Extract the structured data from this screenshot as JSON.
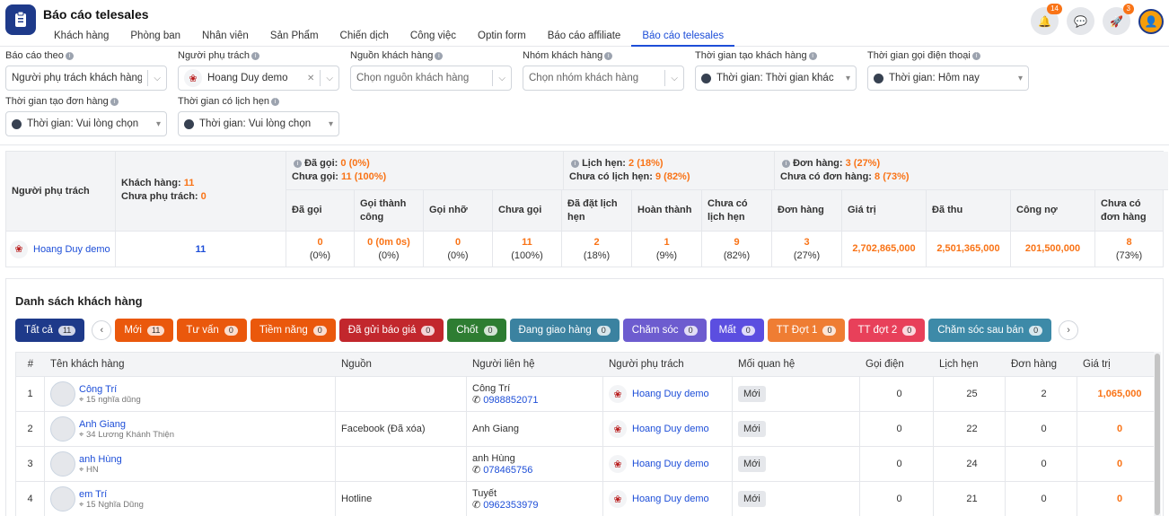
{
  "app": {
    "title": "Báo cáo telesales"
  },
  "nav": {
    "tabs": [
      "Khách hàng",
      "Phòng ban",
      "Nhân viên",
      "Sản Phẩm",
      "Chiến dịch",
      "Công việc",
      "Optin form",
      "Báo cáo affiliate",
      "Báo cáo telesales"
    ],
    "active": "Báo cáo telesales"
  },
  "header": {
    "notif_count": "14",
    "rocket_count": "3"
  },
  "filters": {
    "report_by": {
      "label": "Báo cáo theo",
      "value": "Người phụ trách khách hàng"
    },
    "owner": {
      "label": "Người phụ trách",
      "value": "Hoang Duy demo"
    },
    "source": {
      "label": "Nguồn khách hàng",
      "placeholder": "Chọn nguồn khách hàng"
    },
    "group": {
      "label": "Nhóm khách hàng",
      "placeholder": "Chọn nhóm khách hàng"
    },
    "created_time": {
      "label": "Thời gian tạo khách hàng",
      "value": "Thời gian: Thời gian khác"
    },
    "call_time": {
      "label": "Thời gian gọi điện thoại",
      "value": "Thời gian: Hôm nay"
    },
    "order_time": {
      "label": "Thời gian tạo đơn hàng",
      "value": "Thời gian: Vui lòng chọn"
    },
    "appt_time": {
      "label": "Thời gian có lịch hẹn",
      "value": "Thời gian: Vui lòng chọn"
    }
  },
  "summary": {
    "owner_header": "Người phụ trách",
    "customers_label": "Khách hàng:",
    "customers_value": "11",
    "unassigned_label": "Chưa phụ trách:",
    "unassigned_value": "0",
    "called_label": "Đã gọi:",
    "called_value": "0 (0%)",
    "not_called_label": "Chưa gọi:",
    "not_called_value": "11 (100%)",
    "appt_label": "Lịch hẹn:",
    "appt_value": "2 (18%)",
    "no_appt_label": "Chưa có lịch hẹn:",
    "no_appt_value": "9 (82%)",
    "orders_label": "Đơn hàng:",
    "orders_value": "3 (27%)",
    "no_orders_label": "Chưa có đơn hàng:",
    "no_orders_value": "8 (73%)",
    "cols": [
      "Đã gọi",
      "Gọi thành công",
      "Gọi nhỡ",
      "Chưa gọi",
      "Đã đặt lịch hẹn",
      "Hoàn thành",
      "Chưa có lịch hẹn",
      "Đơn hàng",
      "Giá trị",
      "Đã thu",
      "Công nợ",
      "Chưa có đơn hàng"
    ],
    "row": {
      "owner": "Hoang Duy demo",
      "customers": "11",
      "vals": [
        [
          "0",
          "(0%)"
        ],
        [
          "0 (0m 0s)",
          "(0%)"
        ],
        [
          "0",
          "(0%)"
        ],
        [
          "11",
          "(100%)"
        ],
        [
          "2",
          "(18%)"
        ],
        [
          "1",
          "(9%)"
        ],
        [
          "9",
          "(82%)"
        ],
        [
          "3",
          "(27%)"
        ],
        [
          "2,702,865,000",
          ""
        ],
        [
          "2,501,365,000",
          ""
        ],
        [
          "201,500,000",
          ""
        ],
        [
          "8",
          "(73%)"
        ]
      ]
    }
  },
  "list": {
    "title": "Danh sách khách hàng",
    "chips": [
      {
        "label": "Tất cả",
        "count": "11",
        "color": "#1e3a8a"
      },
      {
        "label": "Mới",
        "count": "11",
        "color": "#ea580c"
      },
      {
        "label": "Tư vấn",
        "count": "0",
        "color": "#ea580c"
      },
      {
        "label": "Tiềm năng",
        "count": "0",
        "color": "#ea580c"
      },
      {
        "label": "Đã gửi báo giá",
        "count": "0",
        "color": "#c2272d"
      },
      {
        "label": "Chốt",
        "count": "0",
        "color": "#2e7d32"
      },
      {
        "label": "Đang giao hàng",
        "count": "0",
        "color": "#3b82a0"
      },
      {
        "label": "Chăm sóc",
        "count": "0",
        "color": "#6d5ccf"
      },
      {
        "label": "Mất",
        "count": "0",
        "color": "#5b4ee0"
      },
      {
        "label": "TT Đợt 1",
        "count": "0",
        "color": "#ef7d33"
      },
      {
        "label": "TT đợt 2",
        "count": "0",
        "color": "#e8405a"
      },
      {
        "label": "Chăm sóc sau bán",
        "count": "0",
        "color": "#3d8aa8"
      }
    ],
    "columns": [
      "#",
      "Tên khách hàng",
      "Nguồn",
      "Người liên hệ",
      "Người phụ trách",
      "Mối quan hệ",
      "Gọi điện",
      "Lịch hẹn",
      "Đơn hàng",
      "Giá trị"
    ],
    "rows": [
      {
        "no": "1",
        "name": "Công Trí",
        "addr": "15 nghĩa dũng",
        "source": "",
        "contact": "Công Trí",
        "phone": "0988852071",
        "owner": "Hoang Duy demo",
        "rel": "Mới",
        "calls": "0",
        "appts": "25",
        "orders": "2",
        "value": "1,065,000"
      },
      {
        "no": "2",
        "name": "Anh Giang",
        "addr": "34 Lương Khánh Thiện",
        "source": "Facebook (Đã xóa)",
        "contact": "Anh Giang",
        "phone": "",
        "owner": "Hoang Duy demo",
        "rel": "Mới",
        "calls": "0",
        "appts": "22",
        "orders": "0",
        "value": "0"
      },
      {
        "no": "3",
        "name": "anh Hùng",
        "addr": "HN",
        "source": "",
        "contact": "anh Hùng",
        "phone": "078465756",
        "owner": "Hoang Duy demo",
        "rel": "Mới",
        "calls": "0",
        "appts": "24",
        "orders": "0",
        "value": "0"
      },
      {
        "no": "4",
        "name": "em Trí",
        "addr": "15 Nghĩa Dũng",
        "source": "Hotline",
        "contact": "Tuyết",
        "phone": "0962353979",
        "owner": "Hoang Duy demo",
        "rel": "Mới",
        "calls": "0",
        "appts": "21",
        "orders": "0",
        "value": "0"
      }
    ]
  }
}
